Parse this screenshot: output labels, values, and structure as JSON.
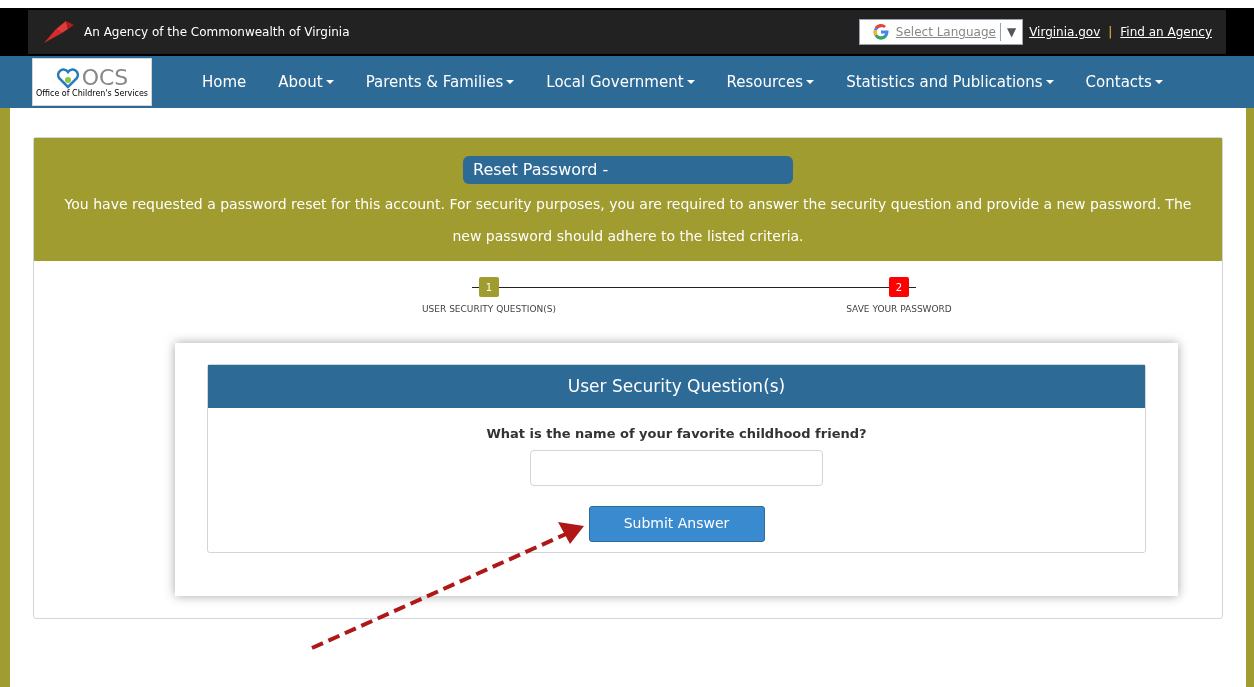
{
  "top_bar": {
    "agency": "An Agency of the Commonwealth of Virginia",
    "language_select": "Select Language",
    "language_caret": "▼",
    "links": [
      "Virginia.gov",
      "Find an Agency"
    ],
    "separator": "|"
  },
  "logo": {
    "mark": "OCS",
    "caption": "Office of Children's Services"
  },
  "nav": [
    {
      "label": "Home",
      "dropdown": false
    },
    {
      "label": "About",
      "dropdown": true
    },
    {
      "label": "Parents & Families",
      "dropdown": true
    },
    {
      "label": "Local Government",
      "dropdown": true
    },
    {
      "label": "Resources",
      "dropdown": true
    },
    {
      "label": "Statistics and Publications",
      "dropdown": true
    },
    {
      "label": "Contacts",
      "dropdown": true
    }
  ],
  "header": {
    "title": "Reset Password -",
    "message": "You have requested a password reset for this account. For security purposes, you are required to answer the security question and provide a new password. The new password should adhere to the listed criteria."
  },
  "steps": [
    {
      "number": "1",
      "label": "USER SECURITY QUESTION(S)",
      "color": "#a09c30"
    },
    {
      "number": "2",
      "label": "SAVE YOUR PASSWORD",
      "color": "#ff0000"
    }
  ],
  "panel": {
    "title": "User Security Question(s)",
    "question": "What is the name of your favorite childhood friend?",
    "button": "Submit Answer"
  }
}
